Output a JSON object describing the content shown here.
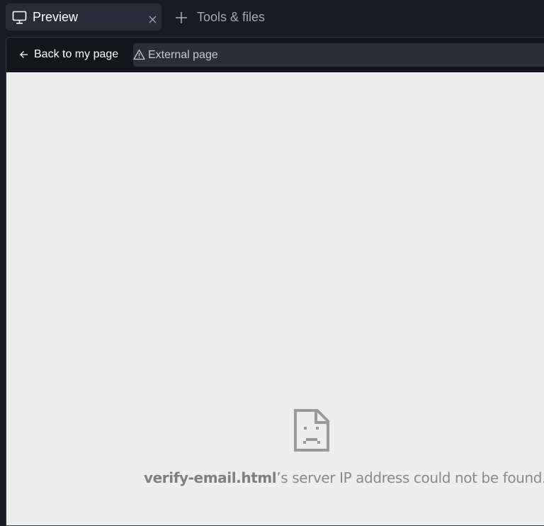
{
  "tabs": {
    "preview": {
      "label": "Preview",
      "icon": "monitor-icon",
      "close_icon": "close-icon"
    },
    "tools": {
      "label": "Tools & files",
      "icon": "plus-icon"
    }
  },
  "navbar": {
    "back_label": "Back to my page",
    "back_icon": "arrow-left-icon",
    "url_label": "External page",
    "url_icon": "warning-icon"
  },
  "error_page": {
    "icon": "sad-document-icon",
    "host": "verify-email.html",
    "message": "’s server IP address could not be found."
  },
  "colors": {
    "tab_bar_bg": "#181b24",
    "active_tab_bg": "#292d37",
    "url_field_bg": "#2a2e37",
    "content_bg": "#eeeeee",
    "error_text": "#8a8a8a"
  }
}
